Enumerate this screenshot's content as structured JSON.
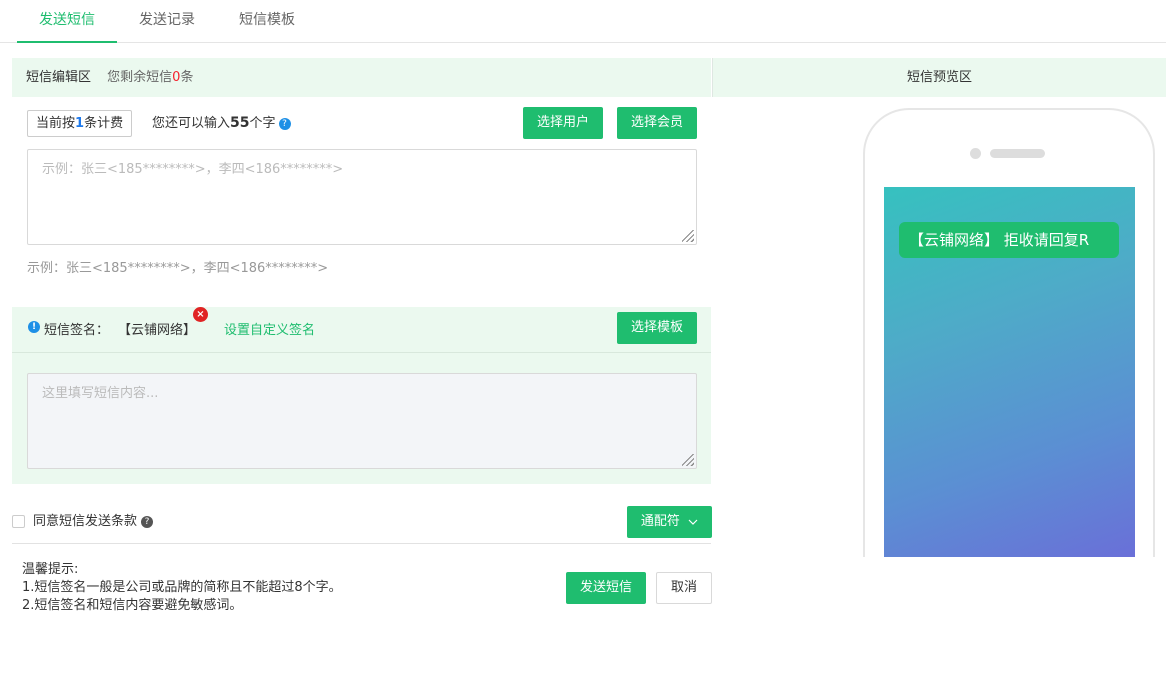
{
  "tabs": [
    {
      "label": "发送短信",
      "active": true
    },
    {
      "label": "发送记录",
      "active": false
    },
    {
      "label": "短信模板",
      "active": false
    }
  ],
  "edit_header": {
    "title": "短信编辑区",
    "remaining_prefix": "您剩余短信",
    "remaining_count": "0",
    "remaining_suffix": "条"
  },
  "preview_header": {
    "title": "短信预览区"
  },
  "billing": {
    "prefix": "当前按",
    "count": "1",
    "suffix": "条计费"
  },
  "input_remaining": {
    "prefix": "您还可以输入",
    "count": "55",
    "suffix": "个字"
  },
  "buttons": {
    "select_user": "选择用户",
    "select_member": "选择会员",
    "select_template": "选择模板",
    "wildcard": "通配符",
    "send": "发送短信",
    "cancel": "取消"
  },
  "recipients": {
    "placeholder": "示例：张三<185********>，李四<186********>",
    "example": "示例：张三<185********>，李四<186********>"
  },
  "signature": {
    "label": "短信签名：",
    "value": "【云铺网络】",
    "custom_link": "设置自定义签名"
  },
  "content": {
    "placeholder": "这里填写短信内容..."
  },
  "agree": {
    "label": "同意短信发送条款",
    "checked": false
  },
  "tips": {
    "title": "温馨提示:",
    "lines": [
      "1.短信签名一般是公司或品牌的简称且不能超过8个字。",
      "2.短信签名和短信内容要避免敏感词。"
    ]
  },
  "preview": {
    "message": "【云铺网络】 拒收请回复R"
  },
  "colors": {
    "accent": "#1fbd6f",
    "panel_bg": "#ebf9ef",
    "alert_red": "#f5222d",
    "info_blue": "#1e90e6"
  },
  "icons": {
    "help": "question-circle-icon",
    "info": "info-circle-icon",
    "remove": "close-circle-icon",
    "dropdown": "chevron-down-icon"
  }
}
